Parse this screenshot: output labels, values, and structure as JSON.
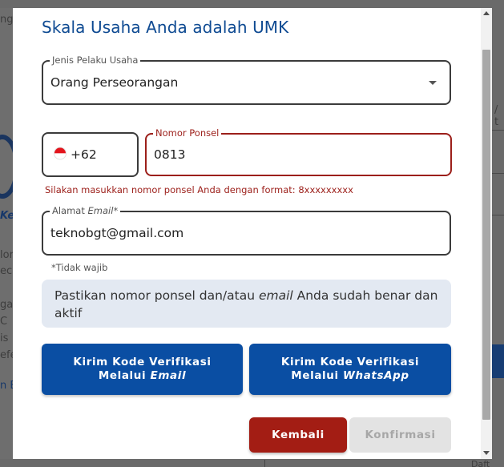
{
  "background": {
    "fragments": [
      "ng",
      "Ke",
      "lor",
      "eca",
      "ga",
      "C",
      "is",
      "efe",
      "n E",
      "/ t",
      "Daft"
    ]
  },
  "modal": {
    "title": "Skala Usaha Anda adalah UMK",
    "business_type": {
      "legend": "Jenis Pelaku Usaha",
      "value": "Orang Perseorangan"
    },
    "phone": {
      "country_code": "+62",
      "legend": "Nomor Ponsel",
      "value": "0813",
      "error": "Silakan masukkan nomor ponsel Anda dengan format: 8xxxxxxxxx"
    },
    "email": {
      "legend_prefix": "Alamat ",
      "legend_italic": "Email",
      "legend_suffix": "*",
      "value": "teknobgt@gmail.com",
      "hint": "*Tidak wajib"
    },
    "info": {
      "part1": "Pastikan nomor ponsel dan/atau ",
      "italic": "email",
      "part2": " Anda sudah benar dan aktif"
    },
    "buttons": {
      "email_line1": "Kirim Kode Verifikasi",
      "email_line2_prefix": "Melalui ",
      "email_line2_italic": "Email",
      "wa_line1": "Kirim Kode Verifikasi",
      "wa_line2_prefix": "Melalui ",
      "wa_line2_italic": "WhatsApp",
      "back": "Kembali",
      "confirm": "Konfirmasi"
    }
  },
  "colors": {
    "primary": "#0a4ea3",
    "danger": "#a31d14",
    "error_text": "#9c1f1a",
    "title": "#0e4a92",
    "info_bg": "#e3e9f2"
  },
  "icons": {
    "flag": "indonesia-flag-icon",
    "dropdown": "chevron-down-icon"
  }
}
